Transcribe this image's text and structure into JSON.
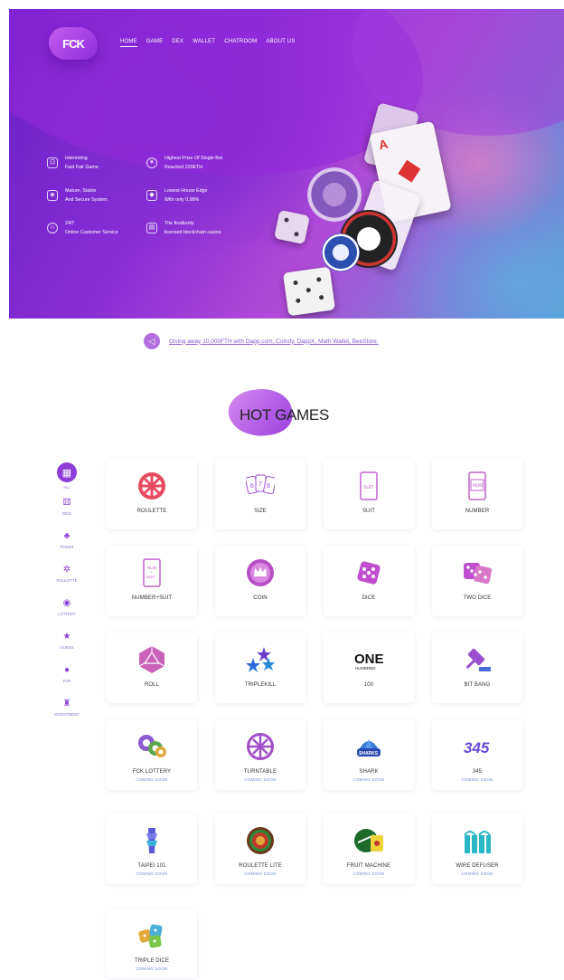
{
  "brand": {
    "logo_text": "FCK",
    "accent": "#8c3ed6"
  },
  "nav": [
    {
      "label": "HOME",
      "active": true
    },
    {
      "label": "GAME"
    },
    {
      "label": "DEX"
    },
    {
      "label": "WALLET"
    },
    {
      "label": "CHATROOM"
    },
    {
      "label": "ABOUT US"
    }
  ],
  "features": [
    {
      "line1": "Interesting",
      "line2": "Fast Fair Game",
      "icon": "gamepad-icon"
    },
    {
      "line1": "Highest Prize Of Single Bet",
      "line2": "Reached 220ETH",
      "icon": "coin-icon"
    },
    {
      "line1": "Mature, Stable",
      "line2": "And Secure System",
      "icon": "shield-icon"
    },
    {
      "line1": "Lowest House Edge",
      "line2": "With only 0.98%",
      "icon": "chart-icon"
    },
    {
      "line1": "24/7",
      "line2": "Online Customer Service",
      "icon": "headset-icon"
    },
    {
      "line1": "The first&only",
      "line2": "licensed blockchain casino",
      "icon": "license-icon"
    }
  ],
  "announcement": {
    "text": "Giving away 10,000FTH with Dapp.com, Coindy, DappX, Math Wallet, BeeStore.",
    "icon": "speaker-icon"
  },
  "section_title": "HOT GAMES",
  "sidebar": [
    {
      "label": "ALL",
      "icon": "all-icon",
      "active": true
    },
    {
      "label": "DICE",
      "icon": "dice-icon"
    },
    {
      "label": "POKER",
      "icon": "poker-icon"
    },
    {
      "label": "ROULETTE",
      "icon": "roulette-icon"
    },
    {
      "label": "LOTTERY",
      "icon": "lottery-icon"
    },
    {
      "label": "GUESS",
      "icon": "guess-icon"
    },
    {
      "label": "FUN",
      "icon": "fun-icon"
    },
    {
      "label": "INVESTMENT",
      "icon": "investment-icon"
    }
  ],
  "games": [
    {
      "name": "ROULETTE",
      "icon": "roulette-wheel-icon"
    },
    {
      "name": "SIZE",
      "icon": "size-cards-icon"
    },
    {
      "name": "SUIT",
      "icon": "suit-card-icon"
    },
    {
      "name": "NUMBER",
      "icon": "number-card-icon"
    },
    {
      "name": "NUMBER+SUIT",
      "icon": "number-suit-card-icon"
    },
    {
      "name": "COIN",
      "icon": "crown-coin-icon"
    },
    {
      "name": "DICE",
      "icon": "dice-icon"
    },
    {
      "name": "TWO DICE",
      "icon": "two-dice-icon"
    },
    {
      "name": "ROLL",
      "icon": "polyhedron-icon"
    },
    {
      "name": "TRIPLEKILL",
      "icon": "three-stars-icon"
    },
    {
      "name": "100",
      "icon": "one-hundred-icon"
    },
    {
      "name": "BIT BANG",
      "icon": "gavel-icon"
    },
    {
      "name": "FCK LOTTERY",
      "icon": "lottery-balls-icon",
      "status": "COMING SOON"
    },
    {
      "name": "TURNTABLE",
      "icon": "turntable-icon",
      "status": "COMING SOON"
    },
    {
      "name": "SHARK",
      "icon": "shark-icon",
      "status": "COMING SOON"
    },
    {
      "name": "345",
      "icon": "345-icon",
      "status": "COMING SOON"
    },
    {
      "name": "TAIPEI 101",
      "icon": "taipei-tower-icon",
      "status": "COMING SOON"
    },
    {
      "name": "ROULETTE LITE",
      "icon": "roulette-lite-icon",
      "status": "COMING SOON"
    },
    {
      "name": "FRUIT MACHINE",
      "icon": "fruit-machine-icon",
      "status": "COMING SOON"
    },
    {
      "name": "WIRE DEFUSER",
      "icon": "wire-defuser-icon",
      "status": "COMING SOON"
    },
    {
      "name": "TRIPLE DICE",
      "icon": "triple-dice-icon",
      "status": "COMING SOON"
    }
  ],
  "art_text": {
    "one": "ONE",
    "hundred": "HUNDRED",
    "sharks": "SHARKS",
    "s345": "345",
    "card_suit": "SUIT",
    "card_num": "NUM",
    "num_suit_a": "NUM",
    "num_suit_b": "+",
    "num_suit_c": "SUIT",
    "size_a": "6",
    "size_b": "7",
    "size_c": "8",
    "card_a": "A"
  }
}
